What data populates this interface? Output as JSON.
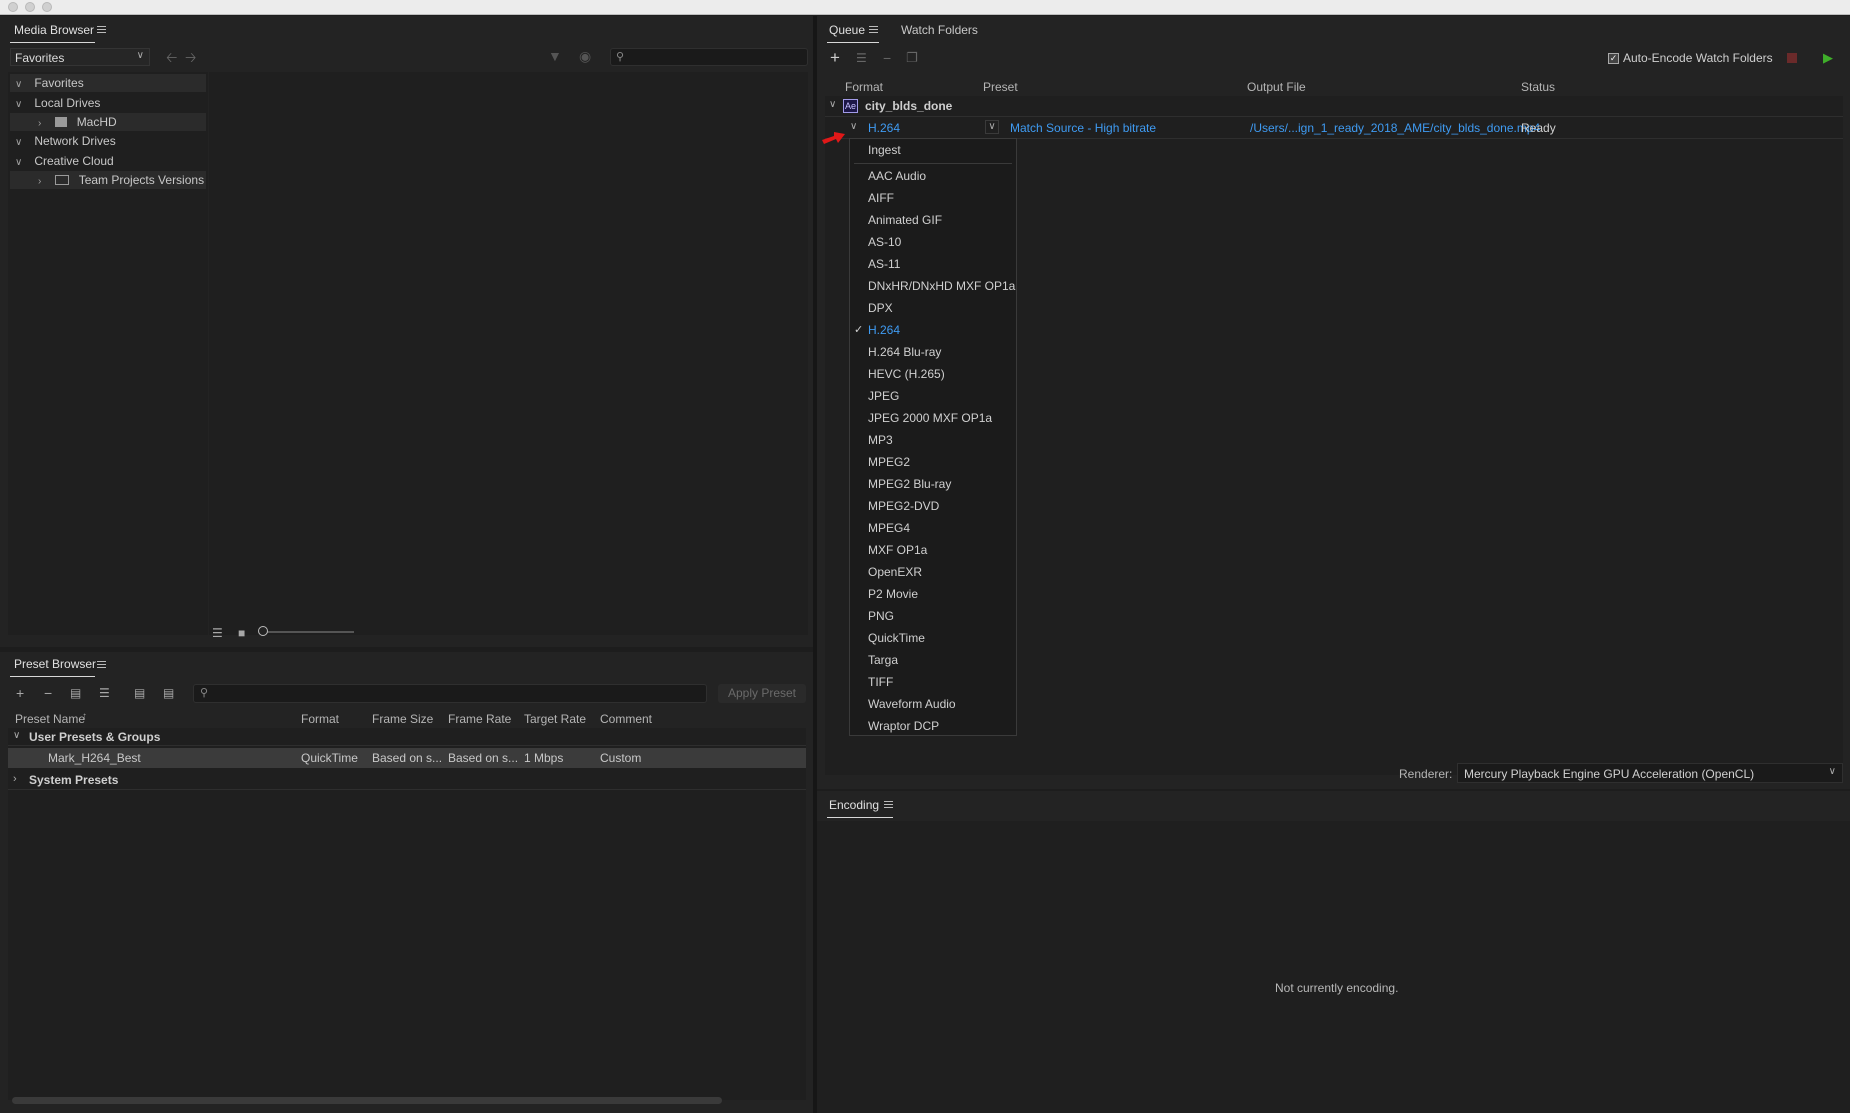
{
  "media_browser": {
    "title": "Media Browser",
    "location_select": "Favorites",
    "tree": [
      {
        "label": "Favorites",
        "chevron": "v"
      },
      {
        "label": "Local Drives",
        "chevron": "v"
      },
      {
        "label": "MacHD",
        "chevron": ">"
      },
      {
        "label": "Network Drives",
        "chevron": "v"
      },
      {
        "label": "Creative Cloud",
        "chevron": "v"
      },
      {
        "label": "Team Projects Versions",
        "chevron": ">"
      }
    ]
  },
  "preset_browser": {
    "title": "Preset Browser",
    "apply_label": "Apply Preset",
    "columns": [
      "Preset Name",
      "Format",
      "Frame Size",
      "Frame Rate",
      "Target Rate",
      "Comment"
    ],
    "groups": {
      "user": "User Presets & Groups",
      "system": "System Presets"
    },
    "row": {
      "name": "Mark_H264_Best",
      "format": "QuickTime",
      "frame_size": "Based on s...",
      "frame_rate": "Based on s...",
      "target_rate": "1 Mbps",
      "comment": "Custom"
    }
  },
  "queue": {
    "tabs": [
      "Queue",
      "Watch Folders"
    ],
    "auto_encode_label": "Auto-Encode Watch Folders",
    "columns": [
      "Format",
      "Preset",
      "Output File",
      "Status"
    ],
    "item": {
      "badge": "Ae",
      "name": "city_blds_done",
      "format": "H.264",
      "preset": "Match Source - High bitrate",
      "output": "/Users/...ign_1_ready_2018_AME/city_blds_done.mp4",
      "status": "Ready"
    },
    "renderer_label": "Renderer:",
    "renderer_value": "Mercury Playback Engine GPU Acceleration (OpenCL)"
  },
  "format_menu": {
    "items": [
      "Ingest",
      "AAC Audio",
      "AIFF",
      "Animated GIF",
      "AS-10",
      "AS-11",
      "DNxHR/DNxHD MXF OP1a",
      "DPX",
      "H.264",
      "H.264 Blu-ray",
      "HEVC (H.265)",
      "JPEG",
      "JPEG 2000 MXF OP1a",
      "MP3",
      "MPEG2",
      "MPEG2 Blu-ray",
      "MPEG2-DVD",
      "MPEG4",
      "MXF OP1a",
      "OpenEXR",
      "P2 Movie",
      "PNG",
      "QuickTime",
      "Targa",
      "TIFF",
      "Waveform Audio",
      "Wraptor DCP"
    ],
    "selected": "H.264"
  },
  "encoding": {
    "title": "Encoding",
    "status": "Not currently encoding."
  },
  "colors": {
    "accent": "#3f9bf2",
    "stop": "#b03a3a",
    "play": "#3fae2a",
    "arrow": "#e01818"
  }
}
